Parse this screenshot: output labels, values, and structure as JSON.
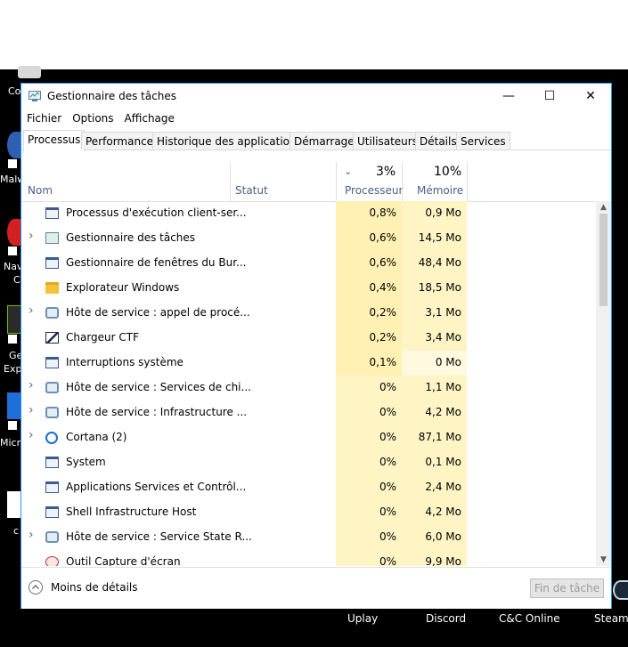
{
  "window": {
    "title": "Gestionnaire des tâches",
    "controls": {
      "minimize": "—",
      "maximize": "☐",
      "close": "✕"
    }
  },
  "menu": [
    "Fichier",
    "Options",
    "Affichage"
  ],
  "tabs": [
    "Processus",
    "Performance",
    "Historique des applications",
    "Démarrage",
    "Utilisateurs",
    "Détails",
    "Services"
  ],
  "columns": {
    "name": "Nom",
    "status": "Statut",
    "cpu_pct": "3%",
    "cpu_label": "Processeur",
    "mem_pct": "10%",
    "mem_label": "Mémoire"
  },
  "processes": [
    {
      "name": "Processus d'exécution client-ser...",
      "cpu": "0,8%",
      "mem": "0,9 Mo",
      "expandable": false,
      "icon": "window-icon"
    },
    {
      "name": "Gestionnaire des tâches",
      "cpu": "0,6%",
      "mem": "14,5 Mo",
      "expandable": true,
      "icon": "taskmgr-icon"
    },
    {
      "name": "Gestionnaire de fenêtres du Bur...",
      "cpu": "0,6%",
      "mem": "48,4 Mo",
      "expandable": false,
      "icon": "window-icon"
    },
    {
      "name": "Explorateur Windows",
      "cpu": "0,4%",
      "mem": "18,5 Mo",
      "expandable": false,
      "icon": "folder-icon"
    },
    {
      "name": "Hôte de service : appel de procé...",
      "cpu": "0,2%",
      "mem": "3,1 Mo",
      "expandable": true,
      "icon": "gear-icon"
    },
    {
      "name": "Chargeur CTF",
      "cpu": "0,2%",
      "mem": "3,4 Mo",
      "expandable": false,
      "icon": "pen-icon"
    },
    {
      "name": "Interruptions système",
      "cpu": "0,1%",
      "mem": "0 Mo",
      "expandable": false,
      "icon": "window-icon"
    },
    {
      "name": "Hôte de service : Services de chi...",
      "cpu": "0%",
      "mem": "1,1 Mo",
      "expandable": true,
      "icon": "gear-icon"
    },
    {
      "name": "Hôte de service : Infrastructure ...",
      "cpu": "0%",
      "mem": "4,2 Mo",
      "expandable": true,
      "icon": "gear-icon"
    },
    {
      "name": "Cortana (2)",
      "cpu": "0%",
      "mem": "87,1 Mo",
      "expandable": true,
      "icon": "cortana-icon"
    },
    {
      "name": "System",
      "cpu": "0%",
      "mem": "0,1 Mo",
      "expandable": false,
      "icon": "window-icon"
    },
    {
      "name": "Applications Services et Contrôl...",
      "cpu": "0%",
      "mem": "2,4 Mo",
      "expandable": false,
      "icon": "window-icon"
    },
    {
      "name": "Shell Infrastructure Host",
      "cpu": "0%",
      "mem": "4,2 Mo",
      "expandable": false,
      "icon": "window-icon"
    },
    {
      "name": "Hôte de service : Service State R...",
      "cpu": "0%",
      "mem": "6,0 Mo",
      "expandable": true,
      "icon": "gear-icon"
    },
    {
      "name": "Outil Capture d'écran",
      "cpu": "0%",
      "mem": "9,9 Mo",
      "expandable": false,
      "icon": "scissors-icon"
    }
  ],
  "footer": {
    "less_details": "Moins de détails",
    "end_task": "Fin de tâche"
  },
  "taskbar": [
    "Uplay",
    "Discord",
    "C&C Online",
    "Steam"
  ],
  "desktop_fragments": [
    "Co",
    "Malw",
    "Nav",
    "C",
    "Ge",
    "Exp",
    "Micro",
    "c"
  ],
  "colors": {
    "cpu_heat_high": "#fff0b3",
    "cpu_heat_mid": "#fff4c4",
    "mem_heat_low": "#fff9e0",
    "accent_border": "#1e90ff",
    "header_text": "#4d6082"
  }
}
